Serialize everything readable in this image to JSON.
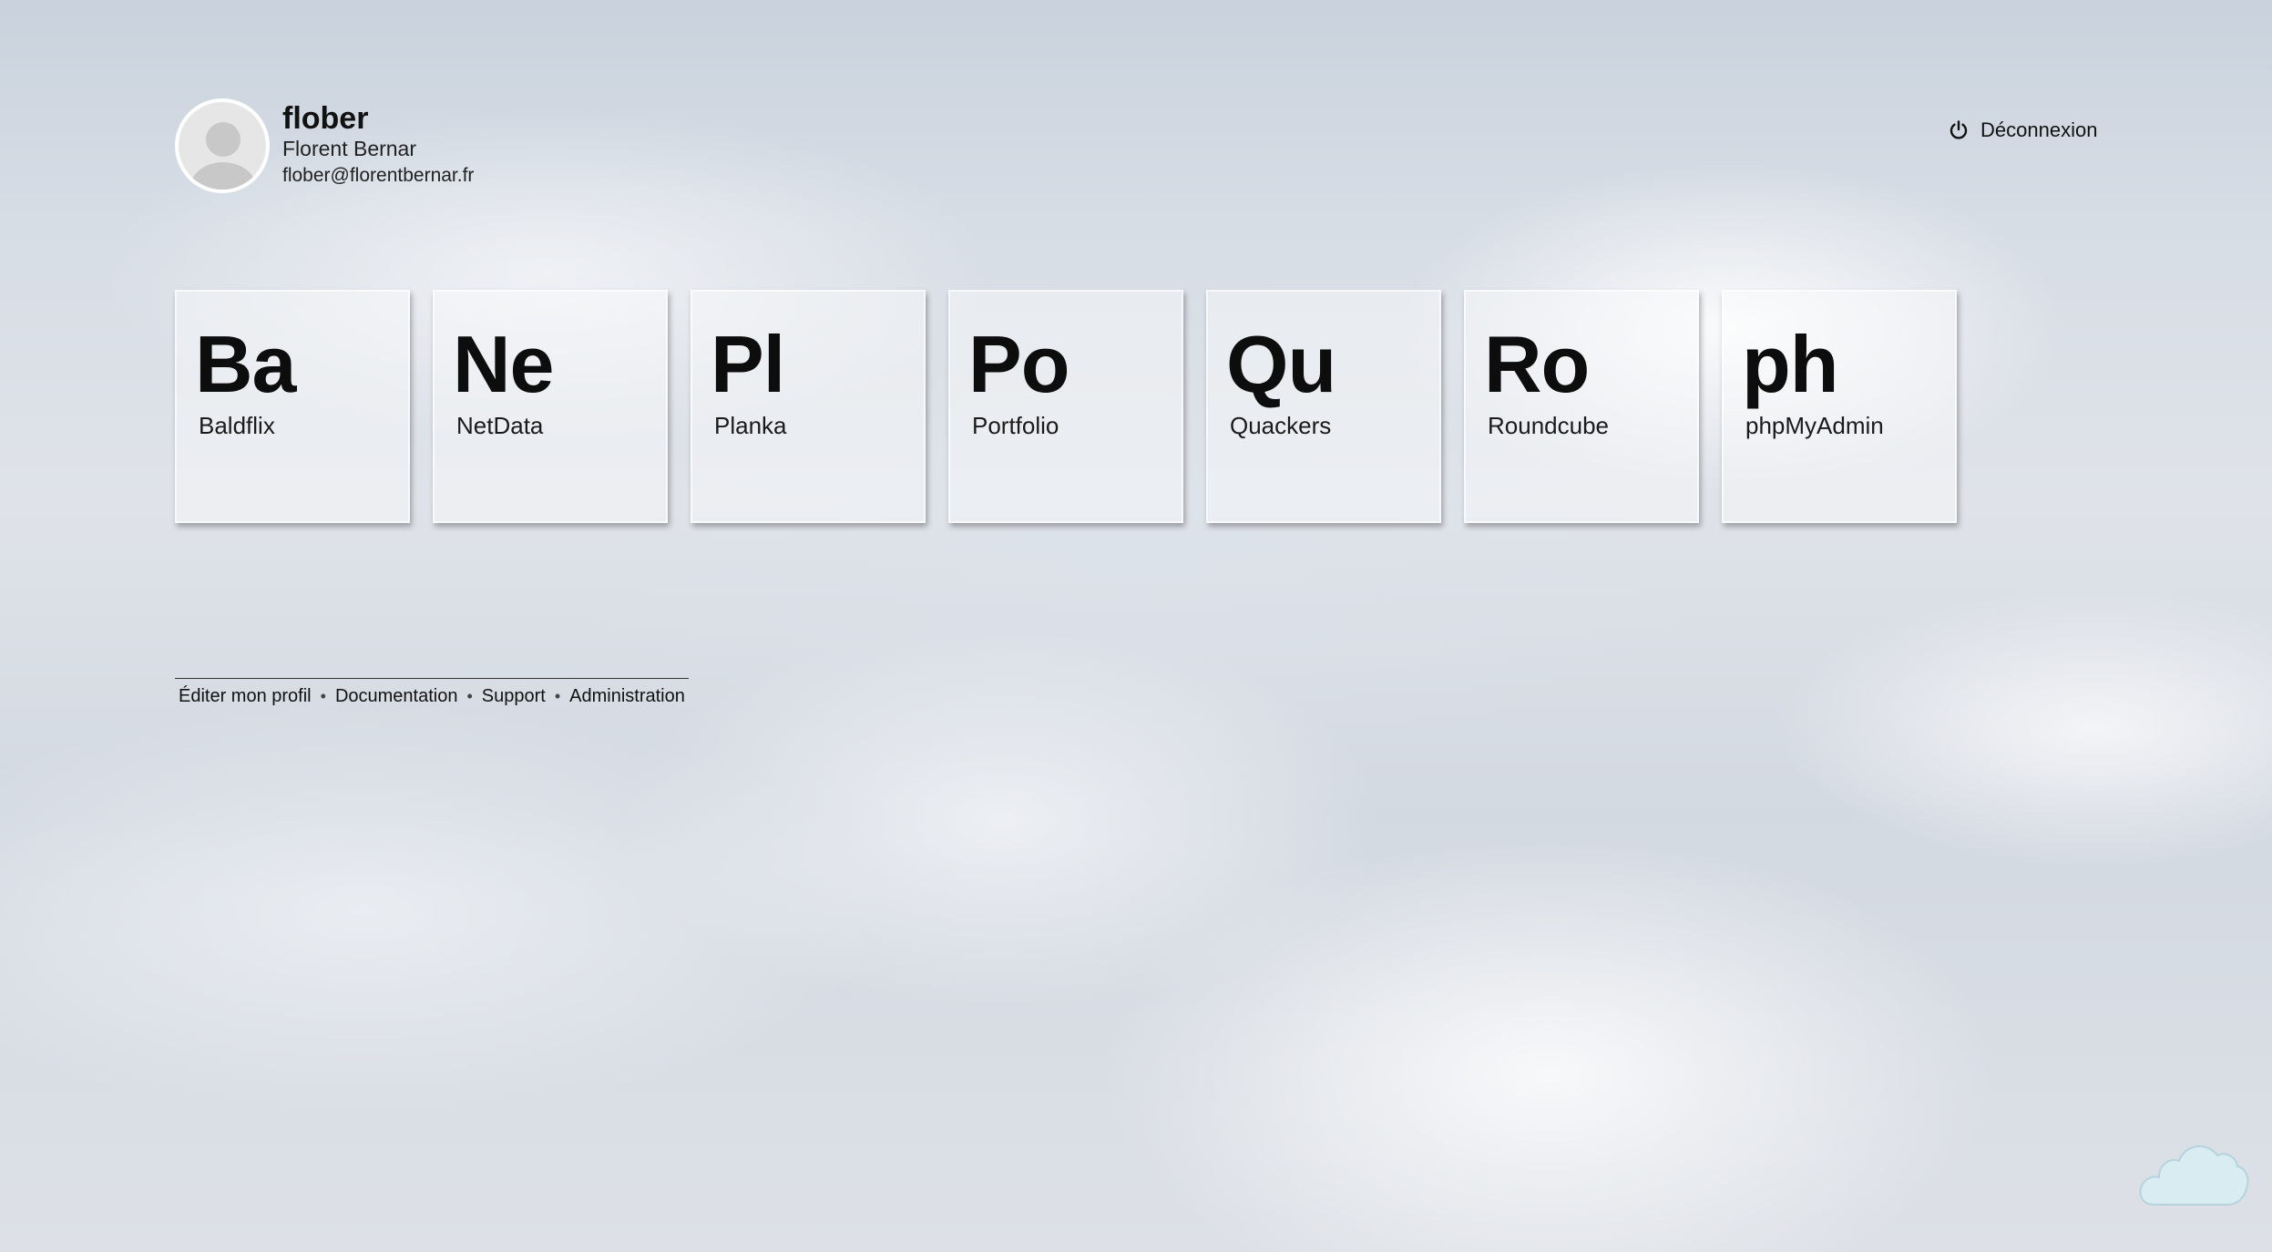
{
  "user": {
    "username": "flober",
    "full_name": "Florent Bernar",
    "email": "flober@florentbernar.fr",
    "avatar_icon": "user-avatar-icon"
  },
  "logout": {
    "label": "Déconnexion",
    "icon": "power-icon"
  },
  "apps": [
    {
      "symbol": "Ba",
      "name": "Baldflix"
    },
    {
      "symbol": "Ne",
      "name": "NetData"
    },
    {
      "symbol": "Pl",
      "name": "Planka"
    },
    {
      "symbol": "Po",
      "name": "Portfolio"
    },
    {
      "symbol": "Qu",
      "name": "Quackers"
    },
    {
      "symbol": "Ro",
      "name": "Roundcube"
    },
    {
      "symbol": "ph",
      "name": "phpMyAdmin"
    }
  ],
  "footer": {
    "links": [
      "Éditer mon profil",
      "Documentation",
      "Support",
      "Administration"
    ],
    "separator": "•"
  },
  "logo": {
    "icon": "cloud-logo-icon",
    "color": "#d8ecf2"
  }
}
